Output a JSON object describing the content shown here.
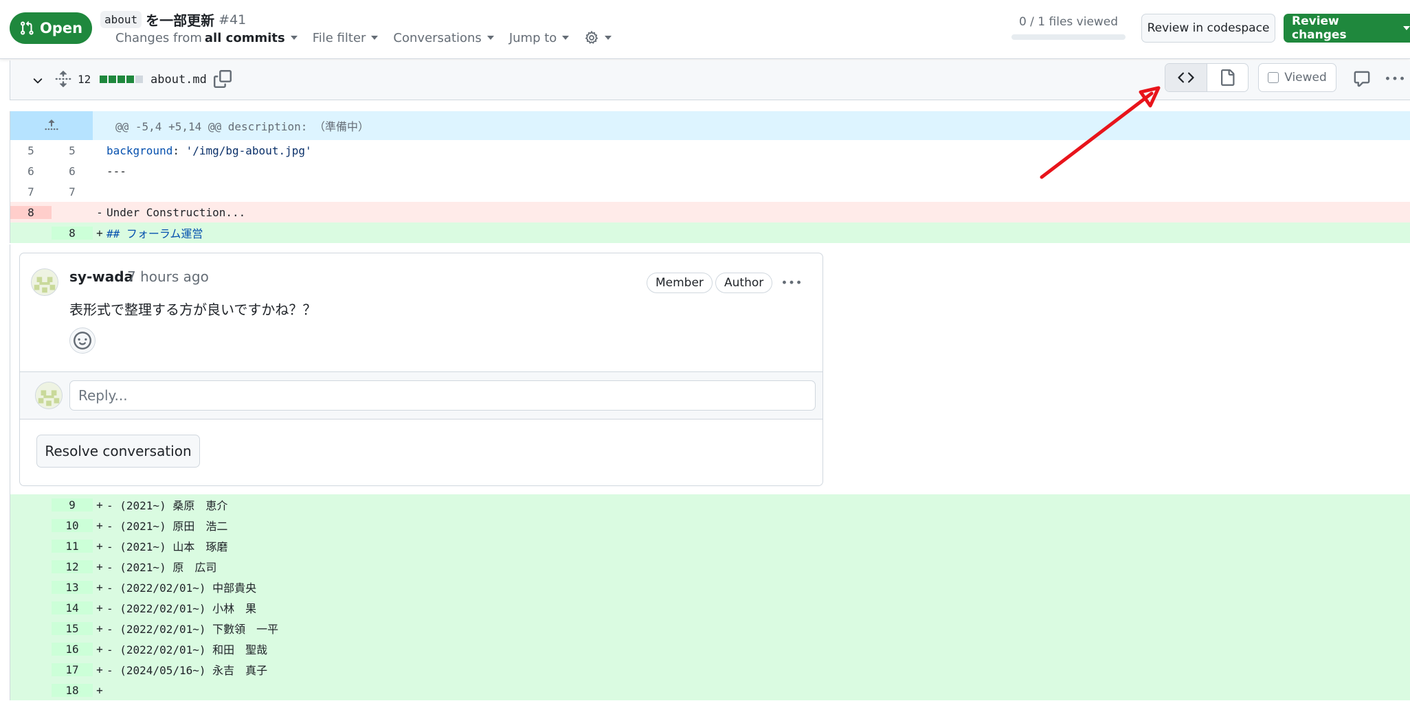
{
  "header": {
    "state": "Open",
    "title_code": "about",
    "title_text": "を一部更新",
    "number": "#41",
    "changes_from_prefix": "Changes from",
    "changes_from_value": "all commits",
    "file_filter": "File filter",
    "conversations": "Conversations",
    "jump_to": "Jump to",
    "files_viewed": "0 / 1 files viewed",
    "review_in_codespace": "Review in codespace",
    "review_changes": "Review changes"
  },
  "file": {
    "changes_count": "12",
    "name": "about.md",
    "viewed_label": "Viewed",
    "diffstat_colors": [
      "#1f883d",
      "#1f883d",
      "#1f883d",
      "#1f883d",
      "#d0d7de"
    ]
  },
  "diff": {
    "hunk_header": "@@ -5,4 +5,14 @@ description: （準備中）",
    "lines": [
      {
        "old": "5",
        "new": "5",
        "marker": "",
        "key": "background",
        "rest": ": ",
        "str": "'/img/bg-about.jpg'"
      },
      {
        "old": "6",
        "new": "6",
        "marker": "",
        "text": "---"
      },
      {
        "old": "7",
        "new": "7",
        "marker": "",
        "text": ""
      },
      {
        "old": "8",
        "new": "",
        "marker": "-",
        "text": "Under Construction..."
      },
      {
        "old": "",
        "new": "8",
        "marker": "+",
        "heading": "## フォーラム運営"
      }
    ],
    "added_lines": [
      {
        "new": "9",
        "marker": "+",
        "text": "- (2021~) 桑原　恵介"
      },
      {
        "new": "10",
        "marker": "+",
        "text": "- (2021~) 原田　浩二"
      },
      {
        "new": "11",
        "marker": "+",
        "text": "- (2021~) 山本　琢磨"
      },
      {
        "new": "12",
        "marker": "+",
        "text": "- (2021~) 原　広司"
      },
      {
        "new": "13",
        "marker": "+",
        "text": "- (2022/02/01~) 中部貴央"
      },
      {
        "new": "14",
        "marker": "+",
        "text": "- (2022/02/01~) 小林　果"
      },
      {
        "new": "15",
        "marker": "+",
        "text": "- (2022/02/01~) 下數領　一平"
      },
      {
        "new": "16",
        "marker": "+",
        "text": "- (2022/02/01~) 和田　聖哉"
      },
      {
        "new": "17",
        "marker": "+",
        "text": "- (2024/05/16~) 永吉　真子"
      },
      {
        "new": "18",
        "marker": "+",
        "text": ""
      }
    ]
  },
  "comment": {
    "author": "sy-wada",
    "time": "7 hours ago",
    "labels": [
      "Member",
      "Author"
    ],
    "body": "表形式で整理する方が良いですかね？？",
    "reply_placeholder": "Reply...",
    "resolve_label": "Resolve conversation"
  },
  "colors": {
    "accent_green": "#1f883d",
    "annotation_arrow": "#e8141b"
  }
}
